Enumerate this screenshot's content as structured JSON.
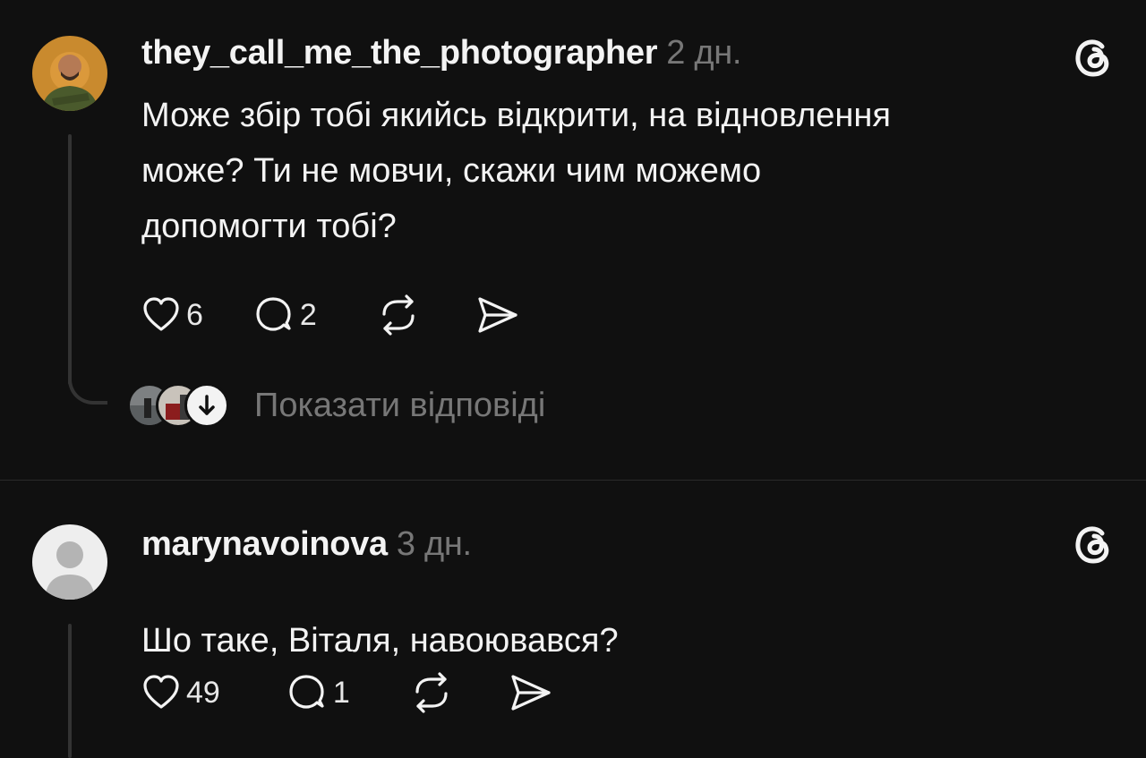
{
  "posts": [
    {
      "username": "they_call_me_the_photographer",
      "time": "2 дн.",
      "text_lines": [
        "Може збір тобі якийсь відкрити, на відновлення",
        "може? Ти не мовчи, скажи чим можемо",
        "допомогти тобі?"
      ],
      "likes": "6",
      "replies": "2",
      "show_replies_label": "Показати відповіді"
    },
    {
      "username": "marynavoinova",
      "time": "3 дн.",
      "text_lines": [
        "Шо таке, Віталя, навоювався?"
      ],
      "likes": "49",
      "replies": "1"
    }
  ],
  "icons": {
    "like": "heart-icon",
    "reply": "comment-bubble-icon",
    "repost": "repost-icon",
    "share": "send-icon",
    "app": "threads-logo-icon",
    "expand": "arrow-down-icon"
  },
  "colors": {
    "background": "#101010",
    "text": "#f3f3f3",
    "muted": "#777777",
    "divider": "#2a2a2a"
  }
}
